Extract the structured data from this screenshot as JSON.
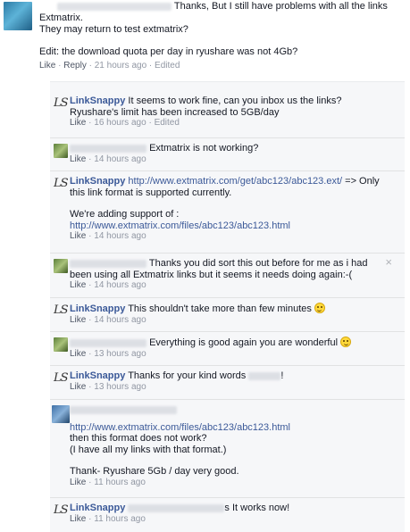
{
  "top_comment": {
    "text_line1": "Thanks, But I still have problems with all the links",
    "text_line2": "Extmatrix.",
    "text_line3": "They may return to test extmatrix?",
    "text_line4": "Edit: the download quota per day in ryushare was not 4Gb?",
    "like": "Like",
    "reply": "Reply",
    "time": "21 hours ago",
    "edited": "Edited"
  },
  "replies": [
    {
      "author": "LinkSnappy",
      "lines": [
        "It seems to work fine, can you inbox us the links?",
        "Ryushare's limit has been increased to 5GB/day"
      ],
      "like": "Like",
      "time": "16 hours ago",
      "edited": "Edited"
    },
    {
      "lines": [
        "Extmatrix is not working?"
      ],
      "like": "Like",
      "time": "14 hours ago"
    },
    {
      "author": "LinkSnappy",
      "link1": "http://www.extmatrix.com/get/abc123/abc123.ext/",
      "after_link1": "=> Only",
      "line2": "this link format is supported currently.",
      "line3": "We're adding support of :",
      "link2": "http://www.extmatrix.com/files/abc123/abc123.html",
      "like": "Like",
      "time": "14 hours ago"
    },
    {
      "lines": [
        "Thanks you did sort this out before for me as i had",
        "been using all Extmatrix links but it seems it needs doing again:-("
      ],
      "like": "Like",
      "time": "14 hours ago",
      "close": "×"
    },
    {
      "author": "LinkSnappy",
      "lines": [
        "This shouldn't take more than few minutes"
      ],
      "like": "Like",
      "time": "14 hours ago"
    },
    {
      "lines": [
        "Everything is good again you are wonderful"
      ],
      "like": "Like",
      "time": "13 hours ago"
    },
    {
      "author": "LinkSnappy",
      "lines": [
        "Thanks for your kind words",
        "!"
      ],
      "like": "Like",
      "time": "13 hours ago"
    },
    {
      "link": "http://www.extmatrix.com/files/abc123/abc123.html",
      "lines": [
        "then this format does not work?",
        "(I have all my links with that format.)",
        "Thank- Ryushare 5Gb / day very good."
      ],
      "like": "Like",
      "time": "11 hours ago"
    },
    {
      "author": "LinkSnappy",
      "lines": [
        "s It works now!"
      ],
      "like": "Like",
      "time": "11 hours ago"
    }
  ],
  "logo_text": "LS",
  "separator": "·"
}
